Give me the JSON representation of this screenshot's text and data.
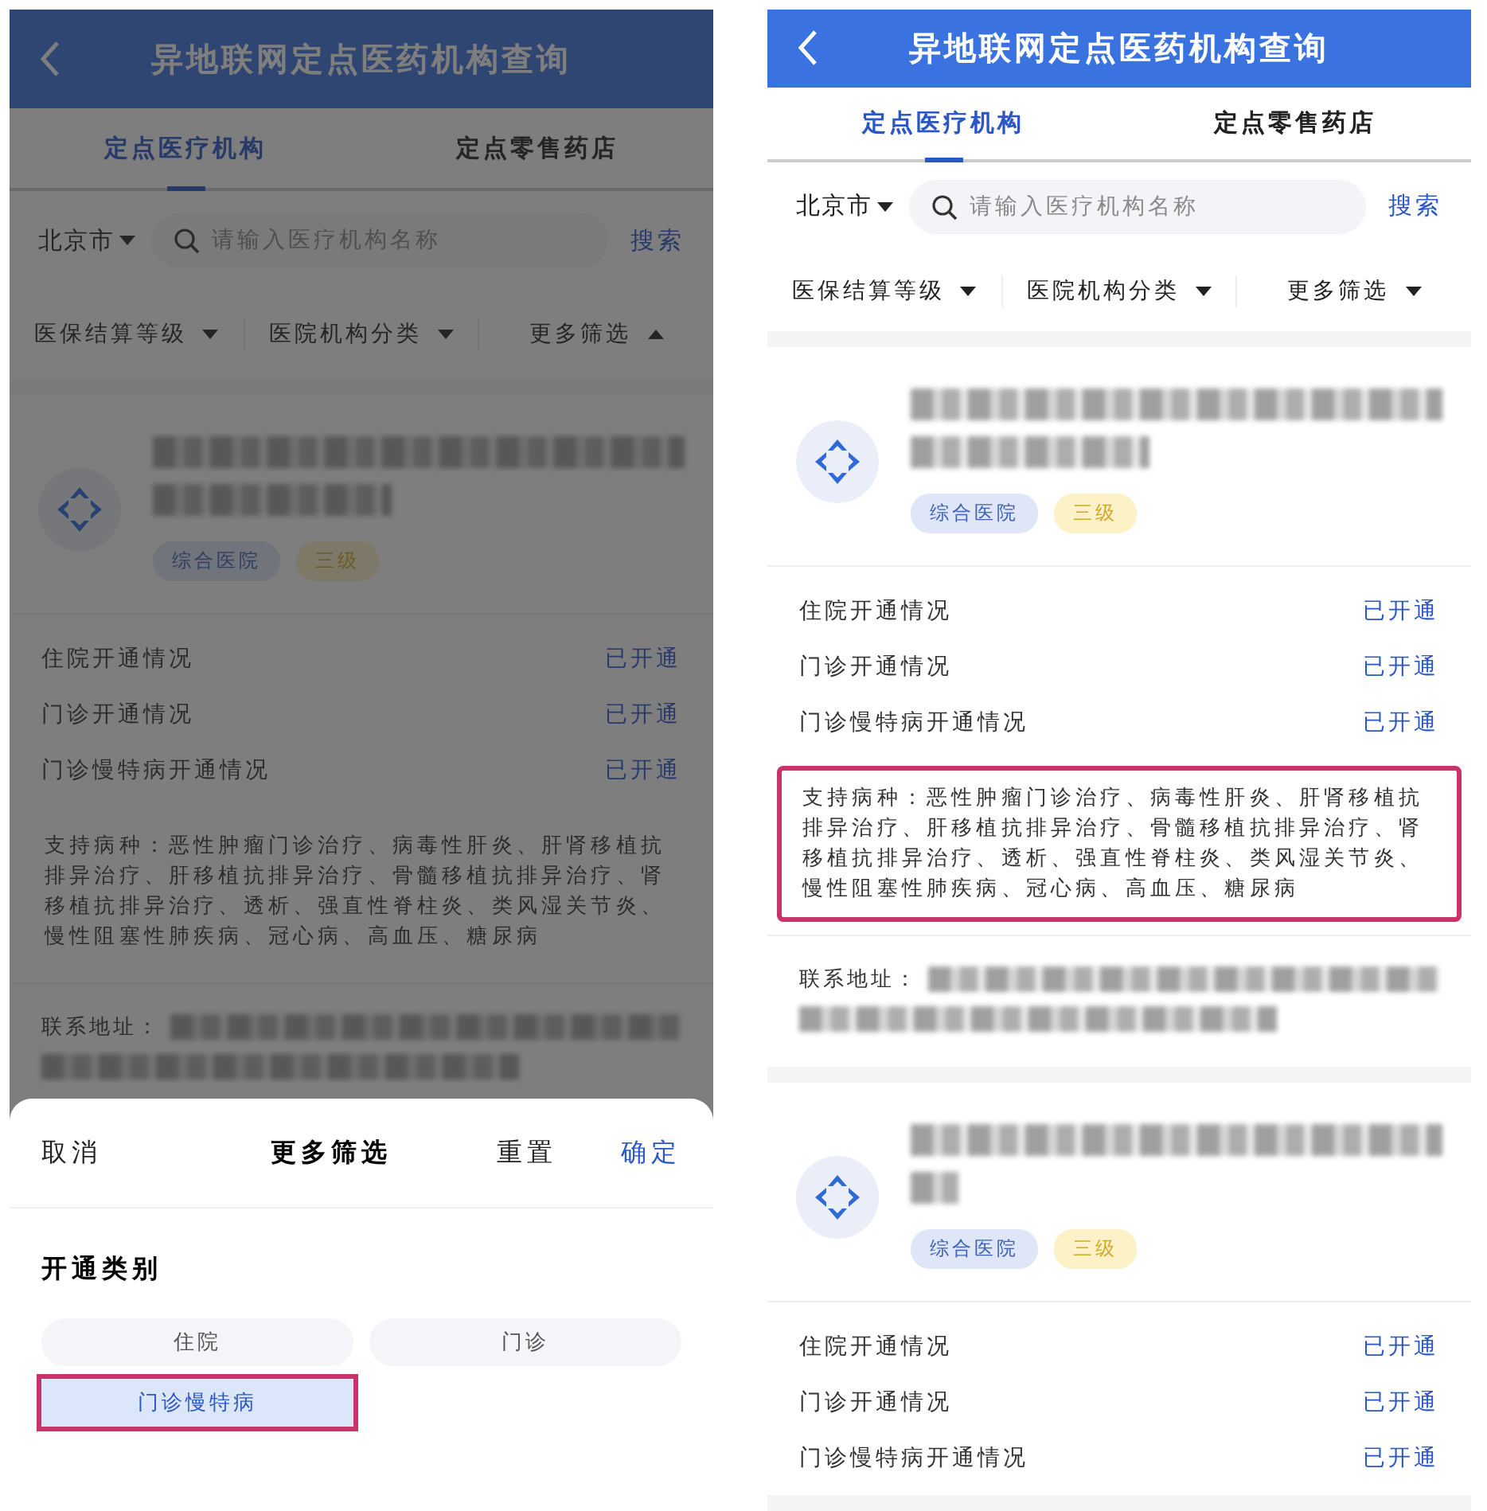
{
  "phones": [
    {
      "header": {
        "title": "异地联网定点医药机构查询"
      },
      "tabs": [
        {
          "label": "定点医疗机构",
          "selected": true
        },
        {
          "label": "定点零售药店",
          "selected": false
        }
      ],
      "city": "北京市",
      "search": {
        "placeholder": "请输入医疗机构名称",
        "button": "搜索"
      },
      "filters": [
        {
          "label": "医保结算等级",
          "expanded": false
        },
        {
          "label": "医院机构分类",
          "expanded": false
        },
        {
          "label": "更多筛选",
          "expanded": true
        }
      ],
      "cards": [
        {
          "tags": [
            {
              "label": "综合医院",
              "kind": "category"
            },
            {
              "label": "三级",
              "kind": "grade"
            }
          ],
          "rows": [
            {
              "label": "住院开通情况",
              "status": "已开通"
            },
            {
              "label": "门诊开通情况",
              "status": "已开通"
            },
            {
              "label": "门诊慢特病开通情况",
              "status": "已开通"
            }
          ],
          "diseases": "支持病种：恶性肿瘤门诊治疗、病毒性肝炎、肝肾移植抗排异治疗、肝移植抗排异治疗、骨髓移植抗排异治疗、肾移植抗排异治疗、透析、强直性脊柱炎、类风湿关节炎、慢性阻塞性肺疾病、冠心病、高血压、糖尿病",
          "diseases_highlighted": false,
          "address_label": "联系地址："
        }
      ],
      "dimmed": true,
      "sheet": {
        "cancel": "取消",
        "title": "更多筛选",
        "reset": "重置",
        "confirm": "确定",
        "section": "开通类别",
        "options": [
          {
            "label": "住院",
            "selected": false,
            "highlighted": false
          },
          {
            "label": "门诊",
            "selected": false,
            "highlighted": false
          },
          {
            "label": "门诊慢特病",
            "selected": true,
            "highlighted": true
          }
        ]
      }
    },
    {
      "header": {
        "title": "异地联网定点医药机构查询"
      },
      "tabs": [
        {
          "label": "定点医疗机构",
          "selected": true
        },
        {
          "label": "定点零售药店",
          "selected": false
        }
      ],
      "city": "北京市",
      "search": {
        "placeholder": "请输入医疗机构名称",
        "button": "搜索"
      },
      "filters": [
        {
          "label": "医保结算等级",
          "expanded": false
        },
        {
          "label": "医院机构分类",
          "expanded": false
        },
        {
          "label": "更多筛选",
          "expanded": false
        }
      ],
      "cards": [
        {
          "tags": [
            {
              "label": "综合医院",
              "kind": "category"
            },
            {
              "label": "三级",
              "kind": "grade"
            }
          ],
          "rows": [
            {
              "label": "住院开通情况",
              "status": "已开通"
            },
            {
              "label": "门诊开通情况",
              "status": "已开通"
            },
            {
              "label": "门诊慢特病开通情况",
              "status": "已开通"
            }
          ],
          "diseases": "支持病种：恶性肿瘤门诊治疗、病毒性肝炎、肝肾移植抗排异治疗、肝移植抗排异治疗、骨髓移植抗排异治疗、肾移植抗排异治疗、透析、强直性脊柱炎、类风湿关节炎、慢性阻塞性肺疾病、冠心病、高血压、糖尿病",
          "diseases_highlighted": true,
          "address_label": "联系地址："
        },
        {
          "tags": [
            {
              "label": "综合医院",
              "kind": "category"
            },
            {
              "label": "三级",
              "kind": "grade"
            }
          ],
          "rows": [
            {
              "label": "住院开通情况",
              "status": "已开通"
            },
            {
              "label": "门诊开通情况",
              "status": "已开通"
            },
            {
              "label": "门诊慢特病开通情况",
              "status": "已开通"
            }
          ]
        }
      ],
      "dimmed": false
    }
  ]
}
